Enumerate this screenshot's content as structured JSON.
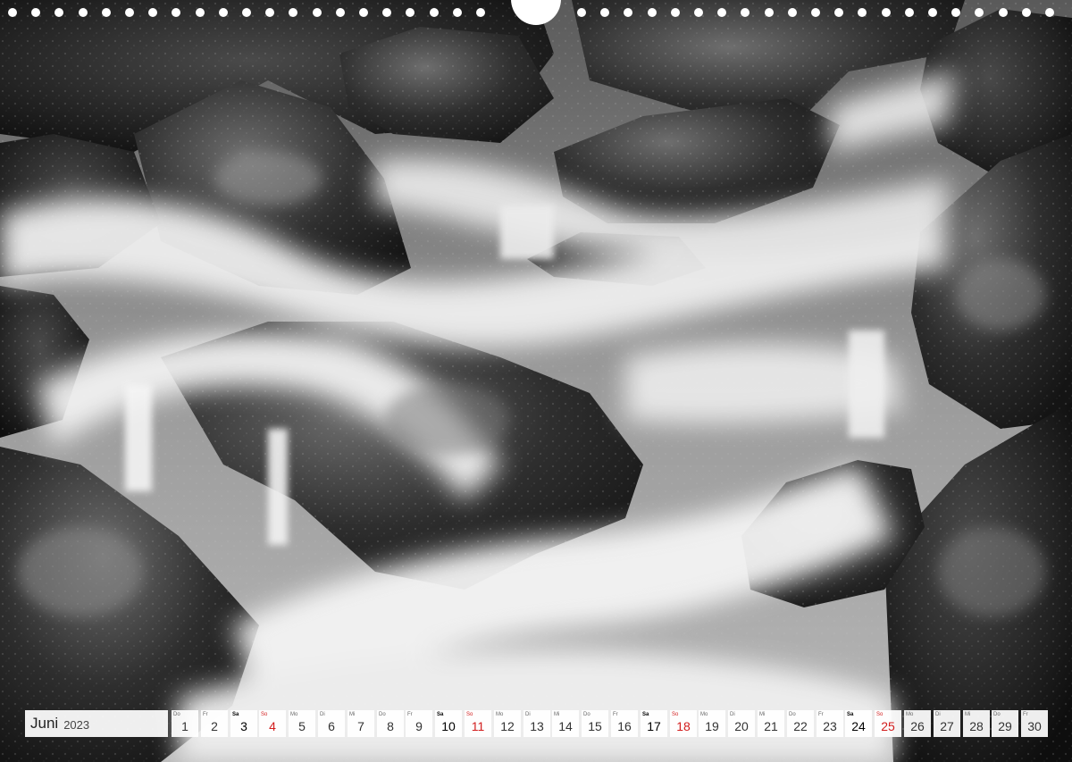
{
  "calendar": {
    "month": "Juni",
    "year": "2023",
    "days": [
      {
        "dow": "Do",
        "num": "1",
        "kind": "weekday"
      },
      {
        "dow": "Fr",
        "num": "2",
        "kind": "weekday"
      },
      {
        "dow": "Sa",
        "num": "3",
        "kind": "sat"
      },
      {
        "dow": "So",
        "num": "4",
        "kind": "sun"
      },
      {
        "dow": "Mo",
        "num": "5",
        "kind": "weekday"
      },
      {
        "dow": "Di",
        "num": "6",
        "kind": "weekday"
      },
      {
        "dow": "Mi",
        "num": "7",
        "kind": "weekday"
      },
      {
        "dow": "Do",
        "num": "8",
        "kind": "weekday"
      },
      {
        "dow": "Fr",
        "num": "9",
        "kind": "weekday"
      },
      {
        "dow": "Sa",
        "num": "10",
        "kind": "sat"
      },
      {
        "dow": "So",
        "num": "11",
        "kind": "sun"
      },
      {
        "dow": "Mo",
        "num": "12",
        "kind": "weekday"
      },
      {
        "dow": "Di",
        "num": "13",
        "kind": "weekday"
      },
      {
        "dow": "Mi",
        "num": "14",
        "kind": "weekday"
      },
      {
        "dow": "Do",
        "num": "15",
        "kind": "weekday"
      },
      {
        "dow": "Fr",
        "num": "16",
        "kind": "weekday"
      },
      {
        "dow": "Sa",
        "num": "17",
        "kind": "sat"
      },
      {
        "dow": "So",
        "num": "18",
        "kind": "sun"
      },
      {
        "dow": "Mo",
        "num": "19",
        "kind": "weekday"
      },
      {
        "dow": "Di",
        "num": "20",
        "kind": "weekday"
      },
      {
        "dow": "Mi",
        "num": "21",
        "kind": "weekday"
      },
      {
        "dow": "Do",
        "num": "22",
        "kind": "weekday"
      },
      {
        "dow": "Fr",
        "num": "23",
        "kind": "weekday"
      },
      {
        "dow": "Sa",
        "num": "24",
        "kind": "sat"
      },
      {
        "dow": "So",
        "num": "25",
        "kind": "sun"
      },
      {
        "dow": "Mo",
        "num": "26",
        "kind": "weekday"
      },
      {
        "dow": "Di",
        "num": "27",
        "kind": "weekday"
      },
      {
        "dow": "Mi",
        "num": "28",
        "kind": "weekday"
      },
      {
        "dow": "Do",
        "num": "29",
        "kind": "weekday"
      },
      {
        "dow": "Fr",
        "num": "30",
        "kind": "weekday"
      }
    ]
  },
  "colors": {
    "sunday": "#d21d1d",
    "text": "#333333",
    "cell_bg": "#f2f2f2"
  },
  "photo": {
    "style": "black-and-white long exposure",
    "hole_count": 44
  }
}
